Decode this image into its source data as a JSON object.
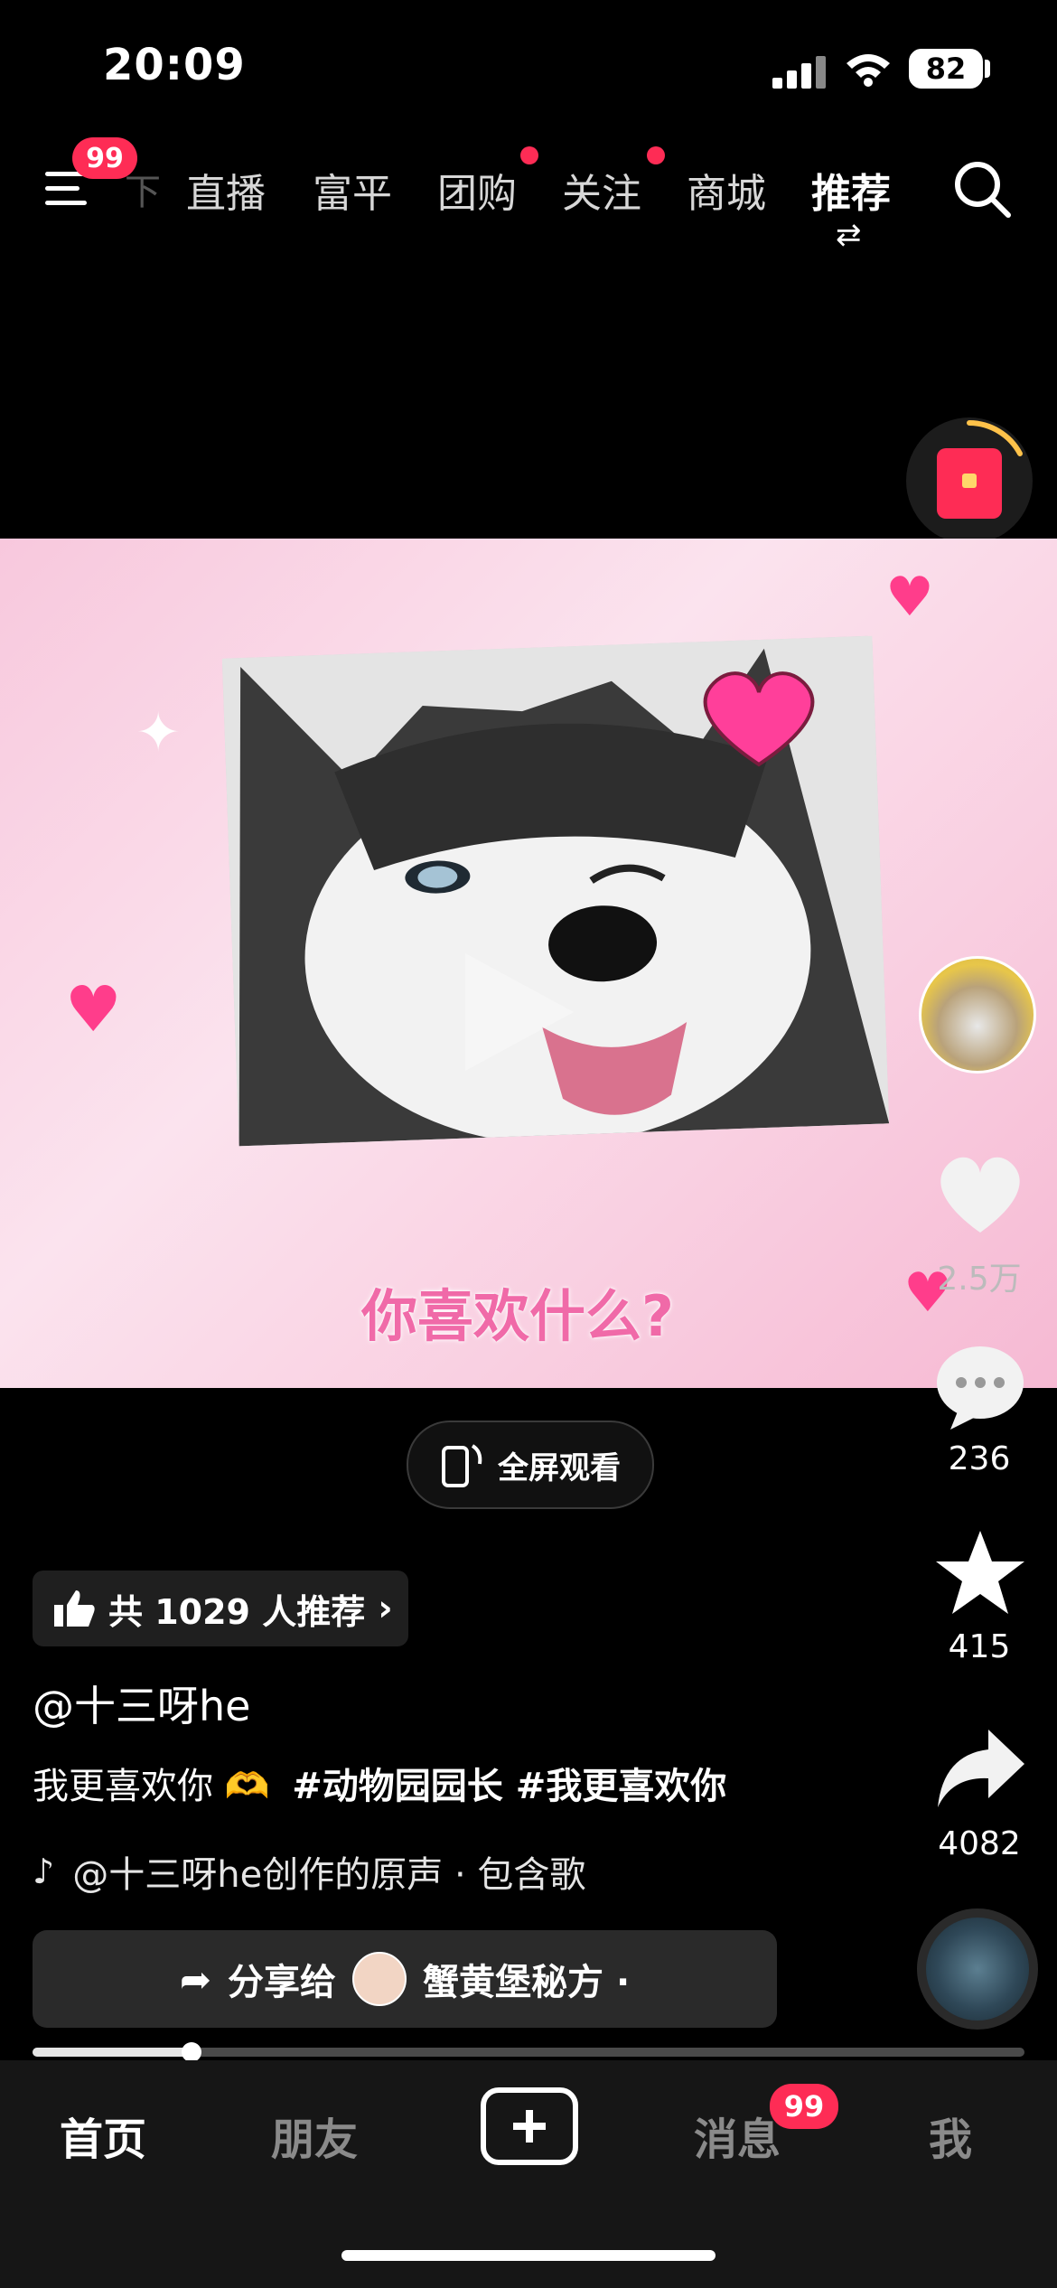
{
  "status_bar": {
    "time": "20:09",
    "battery": "82"
  },
  "top_nav": {
    "menu_badge": "99",
    "faded_tab": "下",
    "tabs": [
      {
        "label": "直播",
        "dot": false
      },
      {
        "label": "富平",
        "dot": false
      },
      {
        "label": "团购",
        "dot": true
      },
      {
        "label": "关注",
        "dot": true
      },
      {
        "label": "商城",
        "dot": false
      },
      {
        "label": "推荐",
        "dot": false,
        "active": true
      }
    ],
    "swap_symbol": "⇄"
  },
  "video": {
    "caption": "你喜欢什么?"
  },
  "actions": {
    "like_count": "2.5万",
    "comment_count": "236",
    "favorite_count": "415",
    "share_count": "4082"
  },
  "fullscreen_label": "全屏观看",
  "recommend_label": "共 1029 人推荐",
  "author": "@十三呀he",
  "description": {
    "text": "我更喜欢你",
    "emoji": "🫶",
    "tags": "#动物园园长 #我更喜欢你"
  },
  "music": "@十三呀he创作的原声 · 包含歌",
  "share_bar": {
    "label": "分享给",
    "target": "蟹黄堡秘方 ·"
  },
  "progress": 0.16,
  "bottom_tabs": {
    "home": "首页",
    "friends": "朋友",
    "messages": "消息",
    "messages_badge": "99",
    "me": "我"
  },
  "colors": {
    "accent": "#fe2c55"
  }
}
